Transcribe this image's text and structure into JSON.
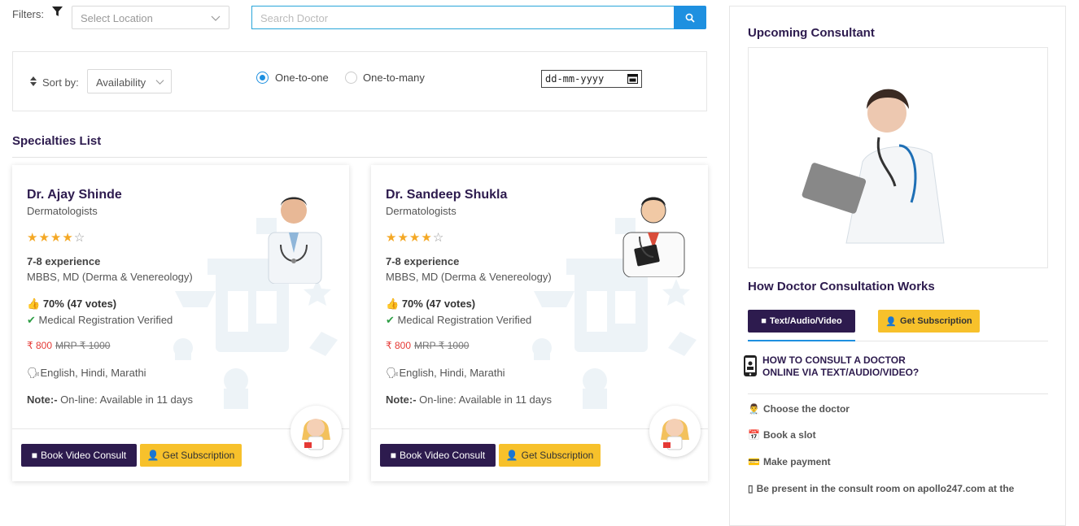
{
  "filters": {
    "label": "Filters:",
    "location_placeholder": "Select Location",
    "search_placeholder": "Search Doctor"
  },
  "sort": {
    "label": "Sort by:",
    "selected": "Availability",
    "radio_options": [
      {
        "label": "One-to-one",
        "checked": true
      },
      {
        "label": "One-to-many",
        "checked": false
      }
    ],
    "date_placeholder": "dd-mm-yyyy"
  },
  "specialties": {
    "title": "Specialties List",
    "doctors": [
      {
        "name": "Dr. Ajay Shinde",
        "specialty": "Dermatologists",
        "rating": 4,
        "rating_max": 5,
        "experience": "7-8 experience",
        "degree": "MBBS, MD (Derma & Venereology)",
        "votes": "70% (47 votes)",
        "verified": "Medical Registration Verified",
        "price": "₹ 800",
        "mrp": "MRP ₹ 1000",
        "languages": "English, Hindi, Marathi",
        "note_label": "Note:-",
        "note_text": "On-line: Available in 11 days",
        "btn_consult": "Book Video Consult",
        "btn_subscription": "Get Subscription"
      },
      {
        "name": "Dr. Sandeep Shukla",
        "specialty": "Dermatologists",
        "rating": 4,
        "rating_max": 5,
        "experience": "7-8 experience",
        "degree": "MBBS, MD (Derma & Venereology)",
        "votes": "70% (47 votes)",
        "verified": "Medical Registration Verified",
        "price": "₹ 800",
        "mrp": "MRP ₹ 1000",
        "languages": "English, Hindi, Marathi",
        "note_label": "Note:-",
        "note_text": "On-line: Available in 11 days",
        "btn_consult": "Book Video Consult",
        "btn_subscription": "Get Subscription"
      }
    ]
  },
  "sidebar": {
    "upcoming_title": "Upcoming Consultant",
    "how_title": "How Doctor Consultation Works",
    "tab_text": "Text/Audio/Video",
    "tab_subscription": "Get Subscription",
    "how_question_line1": "HOW TO CONSULT A DOCTOR",
    "how_question_line2": "ONLINE VIA TEXT/AUDIO/VIDEO?",
    "steps": [
      {
        "icon": "doctor-icon",
        "label": "Choose the doctor"
      },
      {
        "icon": "calendar-icon",
        "label": "Book a slot"
      },
      {
        "icon": "card-icon",
        "label": "Make payment"
      },
      {
        "icon": "phone-icon",
        "label": "Be present in the consult room on apollo247.com at the"
      }
    ]
  },
  "colors": {
    "brand_dark": "#2d1b4e",
    "accent_yellow": "#f7c12b",
    "accent_blue": "#1e90e0",
    "star": "#f4a825",
    "price_red": "#e53935",
    "verified_green": "#2e9e45"
  }
}
